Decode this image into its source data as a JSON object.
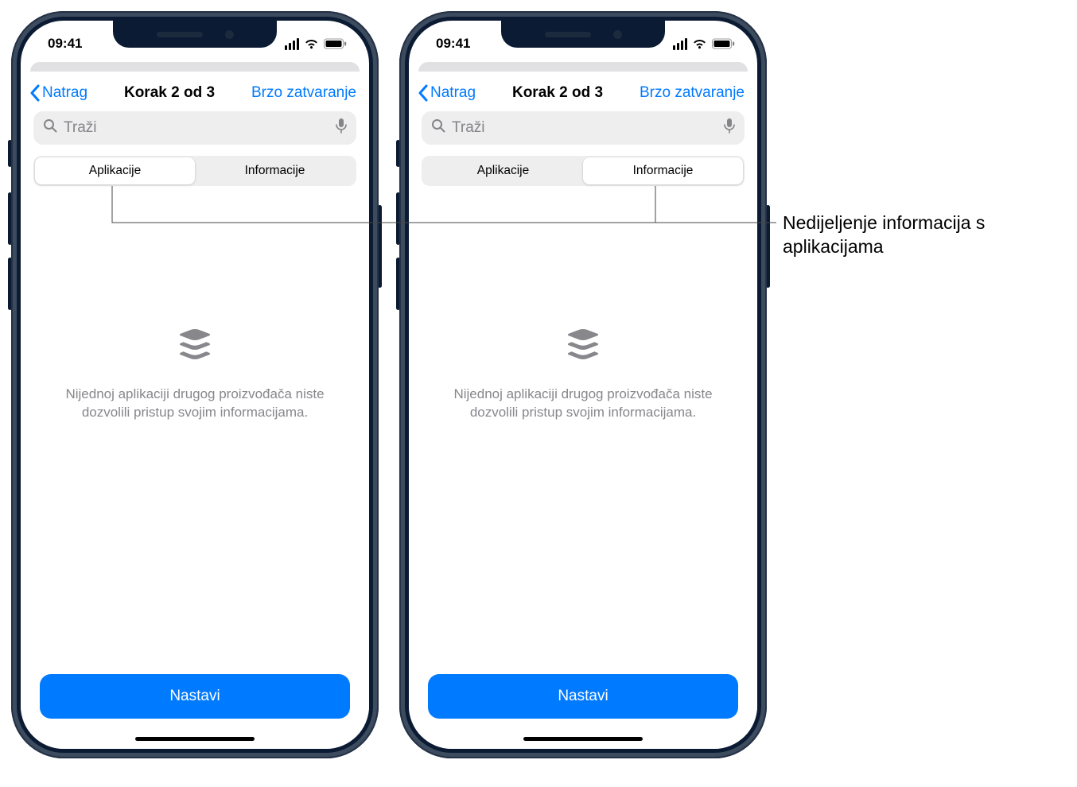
{
  "statusBar": {
    "time": "09:41"
  },
  "nav": {
    "back": "Natrag",
    "title": "Korak 2 od 3",
    "action": "Brzo zatvaranje"
  },
  "search": {
    "placeholder": "Traži"
  },
  "tabs": {
    "apps": "Aplikacije",
    "info": "Informacije"
  },
  "empty": {
    "text": "Nijednoj aplikaciji drugog proizvođača niste dozvolili pristup svojim informacijama."
  },
  "continue": "Nastavi",
  "callout": "Nedijeljenje informacija s aplikacijama"
}
